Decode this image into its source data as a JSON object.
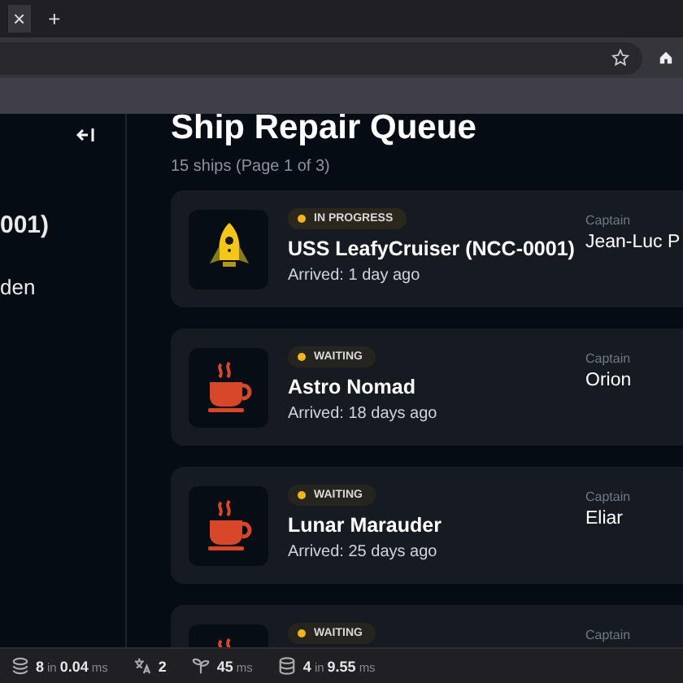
{
  "browser": {
    "tab_close": "×",
    "new_tab": "+"
  },
  "sidebar": {
    "items": [
      {
        "label": "001)",
        "selected": false
      },
      {
        "label": "den",
        "selected": false
      }
    ]
  },
  "header": {
    "title": "Ship Repair Queue",
    "subtitle": "15 ships (Page 1 of 3)"
  },
  "ships": [
    {
      "kind": "in_progress",
      "status_label": "IN PROGRESS",
      "name": "USS LeafyCruiser (NCC-0001)",
      "arrived": "Arrived: 1 day ago",
      "captain_label": "Captain",
      "captain": "Jean-Luc P"
    },
    {
      "kind": "waiting",
      "status_label": "WAITING",
      "name": "Astro Nomad",
      "arrived": "Arrived: 18 days ago",
      "captain_label": "Captain",
      "captain": "Orion"
    },
    {
      "kind": "waiting",
      "status_label": "WAITING",
      "name": "Lunar Marauder",
      "arrived": "Arrived: 25 days ago",
      "captain_label": "Captain",
      "captain": "Eliar"
    },
    {
      "kind": "waiting",
      "status_label": "WAITING",
      "captain_label": "Captain"
    }
  ],
  "status_bar": [
    {
      "kind": "layers",
      "parts": [
        "8",
        "in",
        "0.04",
        "ms"
      ]
    },
    {
      "kind": "translate",
      "parts": [
        "2"
      ]
    },
    {
      "kind": "sprout",
      "parts": [
        "45",
        "ms"
      ]
    },
    {
      "kind": "database",
      "parts": [
        "4",
        "in",
        "9.55",
        "ms"
      ]
    }
  ]
}
